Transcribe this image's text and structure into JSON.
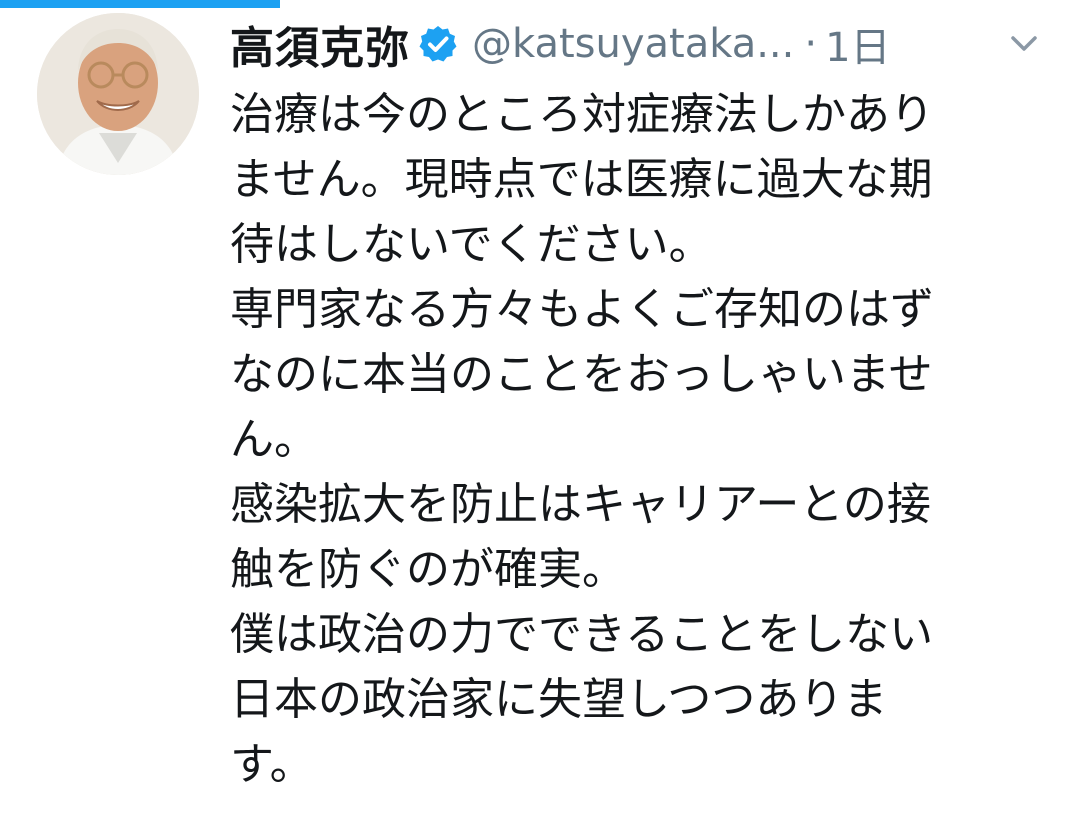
{
  "tweet": {
    "display_name": "高須克弥",
    "handle": "@katsuyataka...",
    "separator": "·",
    "time": "1日",
    "verified": true,
    "lines": [
      "治療は今のところ対症療法しかあり",
      "ません。現時点では医療に過大な期",
      "待はしないでください。",
      "専門家なる方々もよくご存知のはず",
      "なのに本当のことをおっしゃいませ",
      "ん。",
      "感染拡大を防止はキャリアーとの接",
      "触を防ぐのが確実。",
      "僕は政治の力でできることをしない",
      "日本の政治家に失望しつつありま",
      "す。"
    ]
  },
  "icons": {
    "verified": "verified-badge-icon",
    "menu": "chevron-down-icon"
  },
  "colors": {
    "accent": "#1da1f2",
    "text": "#14171a",
    "secondary": "#657786"
  }
}
